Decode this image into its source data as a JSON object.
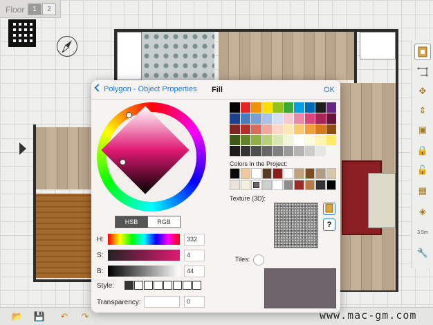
{
  "floor_selector": {
    "label": "Floor",
    "floors": [
      "1",
      "2"
    ],
    "active": "1"
  },
  "popover": {
    "back_label": "Polygon - Object Properties",
    "title": "Fill",
    "ok_label": "OK",
    "mode_tabs": [
      "HSB",
      "RGB"
    ],
    "active_mode": "HSB",
    "sliders": [
      {
        "label": "H:",
        "value": "332"
      },
      {
        "label": "S:",
        "value": "4"
      },
      {
        "label": "B:",
        "value": "44"
      }
    ],
    "style_label": "Style:",
    "transparency_label": "Transparency:",
    "transparency_value": "0",
    "colors_in_project_label": "Colors in the Project:",
    "texture_label": "Texture (3D):",
    "tiles_label": "Tiles:",
    "selected_color": "#6e646c",
    "palette": [
      "#000000",
      "#e52521",
      "#f39200",
      "#ffdd00",
      "#95c11f",
      "#3aaa35",
      "#00a0e3",
      "#0069b4",
      "#1d1d1b",
      "#662483",
      "#1d3f8e",
      "#4b7bbe",
      "#7a9fd4",
      "#a9c2e6",
      "#d4e0f2",
      "#f6c8d0",
      "#e889a6",
      "#d9457d",
      "#a72358",
      "#6a1236",
      "#7c2521",
      "#b22e2a",
      "#d86a5e",
      "#eea99c",
      "#fbd7c8",
      "#fde7b3",
      "#f9c96c",
      "#f29f3a",
      "#d47a1e",
      "#8f4e12",
      "#3e5a1a",
      "#64842a",
      "#8db048",
      "#b9d07a",
      "#dbe7b3",
      "#f0f5dc",
      "#ffffff",
      "#fffbe0",
      "#fff5b0",
      "#ffec66",
      "#1b1b1b",
      "#333333",
      "#4d4d4d",
      "#666666",
      "#808080",
      "#999999",
      "#b3b3b3",
      "#cccccc",
      "#e6e6e6",
      "#f5f5f5"
    ],
    "project_colors": [
      "#0a0a0a",
      "#f1c89c",
      "#ffffff",
      "#5a3a22",
      "#8e1c1c",
      "#fbfbfb",
      "#c0a27c",
      "#7b4b22",
      "#b39c80",
      "#d8c7aa",
      "#e9e3d8",
      "#f5f0de",
      "#6e646c",
      "#cfcfcf",
      "#ffffff",
      "#8d8d8d",
      "#9a2c2c",
      "#b77a44",
      "#333333",
      "#000000"
    ]
  },
  "right_toolbar": [
    "object-tool",
    "line-tool",
    "move-tool",
    "align-tool",
    "group-tool",
    "lock-tool",
    "lock-tool-2",
    "box-tool",
    "box-3d-tool",
    "3.5m",
    "wrench-tool"
  ],
  "watermark": "www.mac-gm.com"
}
